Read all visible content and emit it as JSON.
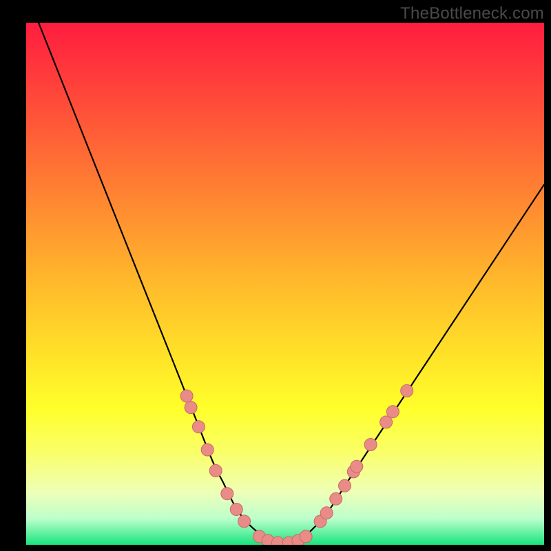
{
  "watermark": "TheBottleneck.com",
  "colors": {
    "frame": "#000000",
    "curve_stroke": "#000000",
    "dot_fill": "#e98b86",
    "dot_stroke": "#c76a65"
  },
  "chart_data": {
    "type": "line",
    "title": "",
    "xlabel": "",
    "ylabel": "",
    "xlim": [
      0,
      100
    ],
    "ylim": [
      0,
      100
    ],
    "grid": false,
    "legend": false,
    "series": [
      {
        "name": "bottleneck-curve",
        "x": [
          0,
          4,
          8,
          12,
          16,
          20,
          24,
          28,
          32,
          36,
          38,
          40,
          42,
          44,
          46,
          48,
          50,
          52,
          54,
          58,
          62,
          66,
          70,
          74,
          78,
          82,
          86,
          90,
          94,
          98,
          100
        ],
        "y": [
          106,
          96,
          86,
          76,
          66,
          56,
          46,
          36,
          26,
          16,
          12,
          8,
          5,
          3,
          1.5,
          0.7,
          0.3,
          0.7,
          1.8,
          6,
          12,
          18,
          24,
          30,
          36,
          42,
          48,
          54,
          60,
          66,
          69
        ]
      }
    ],
    "dots": {
      "name": "highlight-dots",
      "points": [
        {
          "x": 31.0,
          "y": 28.5
        },
        {
          "x": 31.8,
          "y": 26.3
        },
        {
          "x": 33.3,
          "y": 22.6
        },
        {
          "x": 35.0,
          "y": 18.2
        },
        {
          "x": 36.6,
          "y": 14.2
        },
        {
          "x": 38.8,
          "y": 9.8
        },
        {
          "x": 40.6,
          "y": 6.8
        },
        {
          "x": 42.1,
          "y": 4.5
        },
        {
          "x": 45.0,
          "y": 1.6
        },
        {
          "x": 46.7,
          "y": 0.8
        },
        {
          "x": 48.6,
          "y": 0.4
        },
        {
          "x": 50.7,
          "y": 0.4
        },
        {
          "x": 52.5,
          "y": 0.8
        },
        {
          "x": 54.0,
          "y": 1.6
        },
        {
          "x": 56.8,
          "y": 4.5
        },
        {
          "x": 58.0,
          "y": 6.1
        },
        {
          "x": 59.8,
          "y": 8.8
        },
        {
          "x": 61.5,
          "y": 11.3
        },
        {
          "x": 63.2,
          "y": 14.0
        },
        {
          "x": 63.8,
          "y": 15.0
        },
        {
          "x": 66.5,
          "y": 19.2
        },
        {
          "x": 69.5,
          "y": 23.5
        },
        {
          "x": 70.8,
          "y": 25.5
        },
        {
          "x": 73.5,
          "y": 29.5
        }
      ]
    }
  }
}
